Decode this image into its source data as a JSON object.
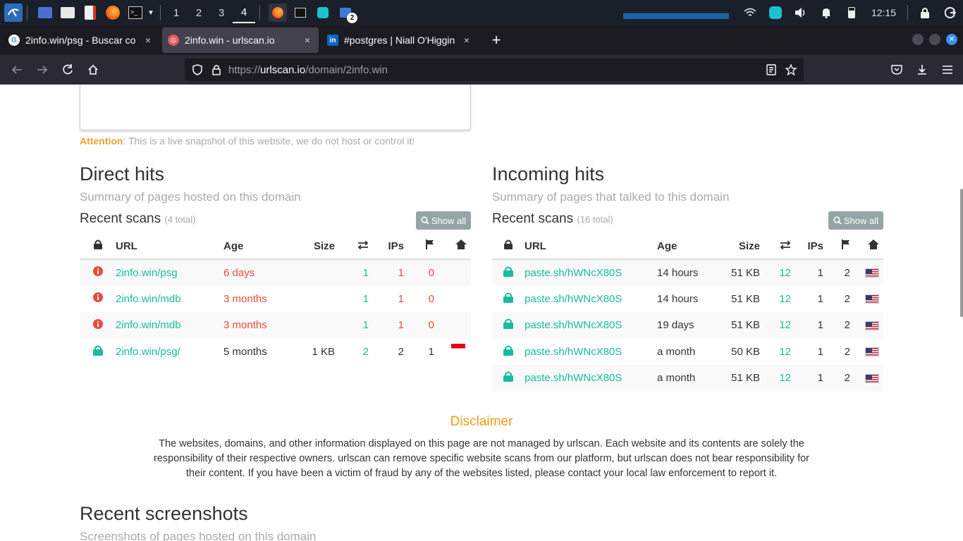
{
  "taskbar": {
    "workspaces": [
      "1",
      "2",
      "3",
      "4"
    ],
    "badge": "2",
    "clock": "12:15"
  },
  "tabs": [
    {
      "title": "2info.win/psg - Buscar co",
      "close": "×"
    },
    {
      "title": "2info.win - urlscan.io",
      "close": "×"
    },
    {
      "title": "#postgres | Niall O'Higgin",
      "close": "×"
    }
  ],
  "new_tab": "+",
  "url": {
    "scheme": "https://",
    "host": "urlscan.io",
    "path": "/domain/2info.win"
  },
  "attention": {
    "label": "Attention",
    "text": ": This is a live snapshot of this website, we do not host or control it!"
  },
  "direct": {
    "title": "Direct hits",
    "subtitle": "Summary of pages hosted on this domain",
    "recent": "Recent scans",
    "total": "(4 total)",
    "show_all": "Show all",
    "headers": {
      "url": "URL",
      "age": "Age",
      "size": "Size",
      "ips": "IPs"
    },
    "rows": [
      {
        "url": "2info.win/psg",
        "age": "6 days",
        "size": "",
        "transfers": "1",
        "ips": "1",
        "countries": "0",
        "status": "info"
      },
      {
        "url": "2info.win/mdb",
        "age": "3 months",
        "size": "",
        "transfers": "1",
        "ips": "1",
        "countries": "0",
        "status": "info"
      },
      {
        "url": "2info.win/mdb",
        "age": "3 months",
        "size": "",
        "transfers": "1",
        "ips": "1",
        "countries": "0",
        "status": "info"
      },
      {
        "url": "2info.win/psg/",
        "age": "5 months",
        "size": "1 KB",
        "transfers": "2",
        "ips": "2",
        "countries": "1",
        "status": "lock"
      }
    ]
  },
  "incoming": {
    "title": "Incoming hits",
    "subtitle": "Summary of pages that talked to this domain",
    "recent": "Recent scans",
    "total": "(16 total)",
    "show_all": "Show all",
    "headers": {
      "url": "URL",
      "age": "Age",
      "size": "Size",
      "ips": "IPs"
    },
    "rows": [
      {
        "url": "paste.sh/hWNcX80S",
        "age": "14 hours",
        "size": "51 KB",
        "transfers": "12",
        "ips": "1",
        "countries": "2"
      },
      {
        "url": "paste.sh/hWNcX80S",
        "age": "14 hours",
        "size": "51 KB",
        "transfers": "12",
        "ips": "1",
        "countries": "2"
      },
      {
        "url": "paste.sh/hWNcX80S",
        "age": "19 days",
        "size": "51 KB",
        "transfers": "12",
        "ips": "1",
        "countries": "2"
      },
      {
        "url": "paste.sh/hWNcX80S",
        "age": "a month",
        "size": "50 KB",
        "transfers": "12",
        "ips": "1",
        "countries": "2"
      },
      {
        "url": "paste.sh/hWNcX80S",
        "age": "a month",
        "size": "51 KB",
        "transfers": "12",
        "ips": "1",
        "countries": "2"
      }
    ]
  },
  "disclaimer": {
    "title": "Disclaimer",
    "text": "The websites, domains, and other information displayed on this page are not managed by urlscan. Each website and its contents are solely the responsibility of their respective owners. urlscan can remove specific website scans from our platform, but urlscan does not bear responsibility for their content. If you have been a victim of fraud by any of the websites listed, please contact your local law enforcement to report it."
  },
  "screenshots": {
    "title": "Recent screenshots",
    "subtitle": "Screenshots of pages hosted on this domain"
  },
  "colors": {
    "link": "#18bc9c",
    "red": "#e74c3c",
    "warning": "#f39c12"
  }
}
